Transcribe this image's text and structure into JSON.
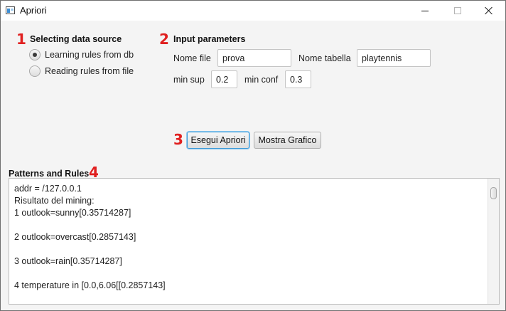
{
  "window": {
    "title": "Apriori",
    "icon": "app-window-icon"
  },
  "data_source": {
    "step": "1",
    "title": "Selecting data source",
    "options": [
      {
        "label": "Learning rules from db",
        "checked": true
      },
      {
        "label": "Reading rules from file",
        "checked": false
      }
    ]
  },
  "input_params": {
    "step": "2",
    "title": "Input parameters",
    "file_label": "Nome file",
    "file_value": "prova",
    "table_label": "Nome tabella",
    "table_value": "playtennis",
    "minsup_label": "min sup",
    "minsup_value": "0.2",
    "minconf_label": "min conf",
    "minconf_value": "0.3"
  },
  "actions": {
    "step": "3",
    "run_label": "Esegui Apriori",
    "chart_label": "Mostra Grafico"
  },
  "results": {
    "step": "4",
    "title": "Patterns and Rules",
    "lines": [
      "addr = /127.0.0.1",
      "Risultato del mining:",
      "1 outlook=sunny[0.35714287]",
      "",
      "2 outlook=overcast[0.2857143]",
      "",
      "3 outlook=rain[0.35714287]",
      "",
      "4 temperature in [0.0,6.06[[0.2857143]"
    ]
  },
  "colors": {
    "step_number": "#e02020",
    "focus_ring": "#3e9ad6"
  }
}
